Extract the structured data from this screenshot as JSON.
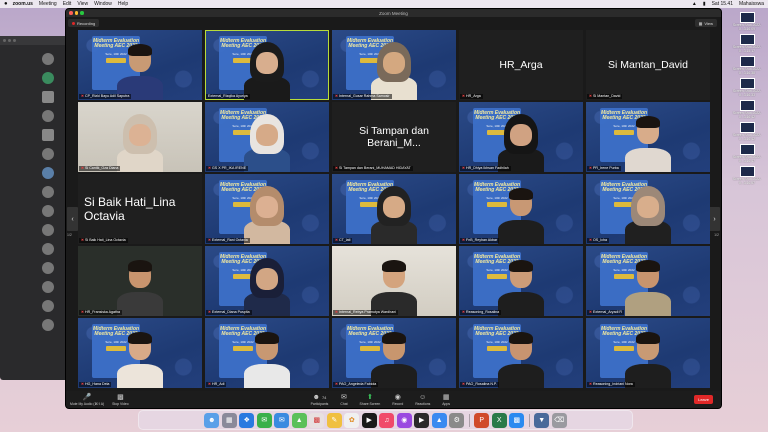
{
  "menubar": {
    "apple": "",
    "items": [
      "zoom.us",
      "Meeting",
      "Edit",
      "View",
      "Window",
      "Help"
    ],
    "clock": "Sat 15.41",
    "user": "Mahaisswa"
  },
  "desktop": {
    "icons": [
      {
        "label": "Screen Shot 2022-0...3.16.09"
      },
      {
        "label": "Screen Shot 2022-0...3.15.17"
      },
      {
        "label": "Screen Shot 2022-0...3.16.38"
      },
      {
        "label": "Screen Shot 2022-0...3.16.33"
      },
      {
        "label": "Screen Shot 2022-0...3.16.42"
      },
      {
        "label": "Screen Shot 2022-0...3.16.42"
      },
      {
        "label": "Screen Shot 2022-0...3.16.47"
      },
      {
        "label": "Screen Shot 2022-0...3.16.57"
      }
    ]
  },
  "zoom": {
    "window_title": "Zoom Meeting",
    "recording_label": "Recording",
    "view_label": "View",
    "poster": {
      "title": "Midterm Evaluation Meeting AEC 2022",
      "subtitle": "Sore, 10th 2022"
    },
    "tiles": [
      {
        "name": "CP_Rizki Bayu Adil Saputra"
      },
      {
        "name": "External_Rizqika Ayuriya"
      },
      {
        "name": "Internal_Gusar Rahma Samosir"
      },
      {
        "name": "HR_Arga",
        "display": "HR_Arga"
      },
      {
        "name": "Si Mantan_David",
        "display": "Si Mantan_David"
      },
      {
        "name": "Si Cantik_Oza Diana"
      },
      {
        "name": "GS X PR_IKA IRENE"
      },
      {
        "name": "Si Tampan dan Berani_MUHAMAD HIDAYAT",
        "display": "Si Tampan dan Berani_M..."
      },
      {
        "name": "HR_Dhiya Ikhsan Fadhilah"
      },
      {
        "name": "PR_Irene Purba"
      },
      {
        "name": "Si Baik Hati_Lina Octavia",
        "display": "Si Baik Hati_Lina Octavia"
      },
      {
        "name": "External_Rani Octavia"
      },
      {
        "name": "CT_lati"
      },
      {
        "name": "FnB_Reyhan Akbar"
      },
      {
        "name": "OS_Icha"
      },
      {
        "name": "HR_Fransiska Agatha"
      },
      {
        "name": "External_Diana Puspita"
      },
      {
        "name": "Internal_Rebya Pramutya Wardhani"
      },
      {
        "name": "Reasoning_Rosalina"
      },
      {
        "name": "External_Aryadi R"
      },
      {
        "name": "HG_Hana Dela"
      },
      {
        "name": "HR_Adi"
      },
      {
        "name": "PAO_Angeleda Fabiola"
      },
      {
        "name": "PAO_Rosalina N.P."
      },
      {
        "name": "Reasoning_Indriani Nora"
      }
    ],
    "pages": {
      "left": "1/2",
      "right": "1/2"
    },
    "toolbar": {
      "mute": "Mute My Audio (⌘⇧A)",
      "video": "Stop Video",
      "participants": "Participants",
      "participants_count": "74",
      "chat": "Chat",
      "share": "Share Screen",
      "record": "Record",
      "reactions": "Reactions",
      "apps": "Apps",
      "leave": "Leave"
    }
  },
  "colors": {
    "active_speaker": "#b8dc3a",
    "leave": "#e02828",
    "share": "#3ac45a"
  }
}
